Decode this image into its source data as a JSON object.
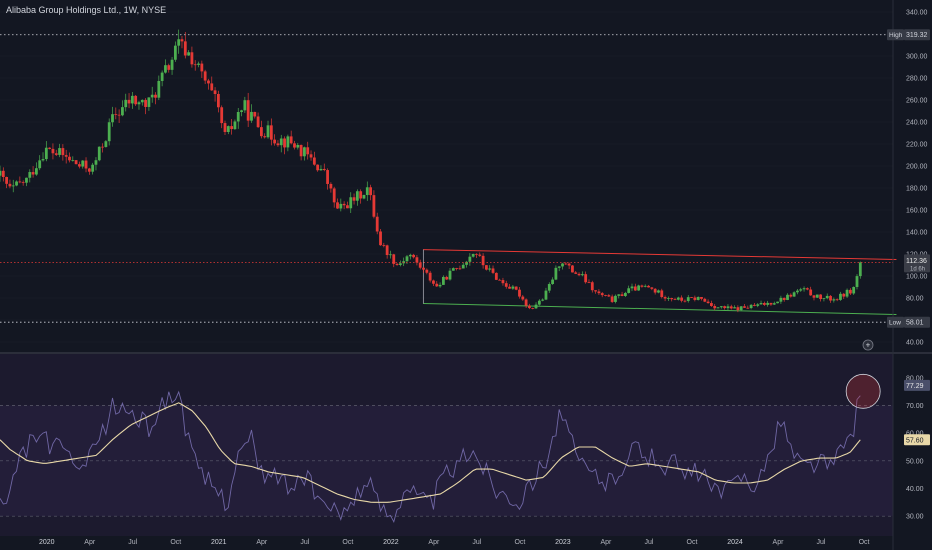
{
  "header": {
    "symbol": "Alibaba Group Holdings Ltd.",
    "interval": "1W",
    "exchange": "NYSE",
    "title_text": "Alibaba Group Holdings Ltd., 1W, NYSE"
  },
  "colors": {
    "background": "#131722",
    "up": "#4caf50",
    "down": "#e53935",
    "grid": "#2a2e39",
    "text": "#b2b5be",
    "rsi_line": "#7e74b8",
    "rsi_ma": "#e8d8a8",
    "resistance": "#e53935",
    "support": "#4caf50"
  },
  "chart_data": [
    {
      "type": "candlestick",
      "title": "Alibaba Group Holdings Ltd., 1W, NYSE",
      "ylim": [
        40,
        340
      ],
      "y_ticks": [
        "340.00",
        "320.00",
        "300.00",
        "280.00",
        "260.00",
        "240.00",
        "220.00",
        "200.00",
        "180.00",
        "160.00",
        "140.00",
        "120.00",
        "100.00",
        "80.00",
        "60.00",
        "40.00"
      ],
      "x_ticks": [
        "2020",
        "Apr",
        "Jul",
        "Oct",
        "2021",
        "Apr",
        "Jul",
        "Oct",
        "2022",
        "Apr",
        "Jul",
        "Oct",
        "2023",
        "Apr",
        "Jul",
        "Oct",
        "2024",
        "Apr",
        "Jul",
        "Oct"
      ],
      "x_start": "2019-06",
      "x_end": "2024-11",
      "markers": {
        "high": {
          "label": "High",
          "value": 319.32,
          "value_text": "319.32"
        },
        "low": {
          "label": "Low",
          "value": 58.01,
          "value_text": "58.01"
        },
        "current": {
          "value": 112.36,
          "value_text": "112.36",
          "countdown": "1d 6h"
        }
      },
      "trendlines": {
        "resistance": {
          "from": [
            2022.2,
            124
          ],
          "to": [
            2024.95,
            115
          ]
        },
        "support": {
          "from": [
            2022.2,
            75
          ],
          "to": [
            2024.95,
            65
          ]
        }
      },
      "close_path": [
        [
          2019.5,
          206
        ],
        [
          2019.6,
          212
        ],
        [
          2019.7,
          200
        ],
        [
          2019.8,
          178
        ],
        [
          2019.9,
          188
        ],
        [
          2020.0,
          215
        ],
        [
          2020.1,
          210
        ],
        [
          2020.2,
          200
        ],
        [
          2020.28,
          198
        ],
        [
          2020.4,
          245
        ],
        [
          2020.5,
          260
        ],
        [
          2020.6,
          255
        ],
        [
          2020.7,
          285
        ],
        [
          2020.78,
          310
        ],
        [
          2020.85,
          300
        ],
        [
          2020.92,
          280
        ],
        [
          2021.0,
          255
        ],
        [
          2021.05,
          225
        ],
        [
          2021.1,
          240
        ],
        [
          2021.15,
          255
        ],
        [
          2021.25,
          235
        ],
        [
          2021.35,
          225
        ],
        [
          2021.45,
          220
        ],
        [
          2021.55,
          205
        ],
        [
          2021.62,
          195
        ],
        [
          2021.7,
          160
        ],
        [
          2021.8,
          170
        ],
        [
          2021.88,
          180
        ],
        [
          2021.95,
          130
        ],
        [
          2022.05,
          110
        ],
        [
          2022.12,
          120
        ],
        [
          2022.2,
          105
        ],
        [
          2022.28,
          90
        ],
        [
          2022.35,
          102
        ],
        [
          2022.42,
          110
        ],
        [
          2022.5,
          123
        ],
        [
          2022.55,
          110
        ],
        [
          2022.65,
          95
        ],
        [
          2022.75,
          85
        ],
        [
          2022.82,
          70
        ],
        [
          2022.9,
          80
        ],
        [
          2023.0,
          115
        ],
        [
          2023.06,
          105
        ],
        [
          2023.12,
          100
        ],
        [
          2023.2,
          85
        ],
        [
          2023.3,
          78
        ],
        [
          2023.4,
          88
        ],
        [
          2023.5,
          90
        ],
        [
          2023.6,
          82
        ],
        [
          2023.7,
          78
        ],
        [
          2023.8,
          80
        ],
        [
          2023.9,
          72
        ],
        [
          2024.0,
          70
        ],
        [
          2024.1,
          72
        ],
        [
          2024.2,
          75
        ],
        [
          2024.3,
          80
        ],
        [
          2024.4,
          88
        ],
        [
          2024.5,
          80
        ],
        [
          2024.6,
          79
        ],
        [
          2024.65,
          84
        ],
        [
          2024.7,
          88
        ],
        [
          2024.74,
          112
        ]
      ]
    },
    {
      "type": "line",
      "title": "RSI",
      "ylim": [
        25,
        85
      ],
      "y_ticks": [
        "80.00",
        "70.00",
        "60.00",
        "50.00",
        "40.00",
        "30.00"
      ],
      "levels": [
        70,
        50,
        30
      ],
      "readouts": {
        "rsi": 77.29,
        "rsi_text": "77.29",
        "ma": 57.6,
        "ma_text": "57.60"
      },
      "rsi_path": [
        [
          2019.5,
          55
        ],
        [
          2019.6,
          62
        ],
        [
          2019.7,
          40
        ],
        [
          2019.78,
          32
        ],
        [
          2019.85,
          50
        ],
        [
          2019.95,
          60
        ],
        [
          2020.05,
          55
        ],
        [
          2020.15,
          52
        ],
        [
          2020.22,
          45
        ],
        [
          2020.3,
          55
        ],
        [
          2020.4,
          70
        ],
        [
          2020.5,
          68
        ],
        [
          2020.6,
          62
        ],
        [
          2020.7,
          72
        ],
        [
          2020.78,
          75
        ],
        [
          2020.84,
          55
        ],
        [
          2020.9,
          45
        ],
        [
          2021.0,
          40
        ],
        [
          2021.06,
          35
        ],
        [
          2021.12,
          52
        ],
        [
          2021.2,
          58
        ],
        [
          2021.28,
          42
        ],
        [
          2021.35,
          46
        ],
        [
          2021.42,
          40
        ],
        [
          2021.5,
          45
        ],
        [
          2021.58,
          38
        ],
        [
          2021.65,
          32
        ],
        [
          2021.72,
          30
        ],
        [
          2021.8,
          38
        ],
        [
          2021.88,
          42
        ],
        [
          2021.95,
          34
        ],
        [
          2022.02,
          30
        ],
        [
          2022.1,
          42
        ],
        [
          2022.18,
          36
        ],
        [
          2022.25,
          35
        ],
        [
          2022.32,
          45
        ],
        [
          2022.4,
          48
        ],
        [
          2022.48,
          55
        ],
        [
          2022.55,
          48
        ],
        [
          2022.62,
          40
        ],
        [
          2022.7,
          38
        ],
        [
          2022.78,
          35
        ],
        [
          2022.85,
          45
        ],
        [
          2022.92,
          52
        ],
        [
          2023.0,
          68
        ],
        [
          2023.05,
          58
        ],
        [
          2023.12,
          48
        ],
        [
          2023.2,
          45
        ],
        [
          2023.28,
          42
        ],
        [
          2023.35,
          48
        ],
        [
          2023.42,
          55
        ],
        [
          2023.5,
          52
        ],
        [
          2023.58,
          48
        ],
        [
          2023.65,
          50
        ],
        [
          2023.72,
          44
        ],
        [
          2023.8,
          46
        ],
        [
          2023.88,
          40
        ],
        [
          2023.95,
          38
        ],
        [
          2024.05,
          45
        ],
        [
          2024.12,
          42
        ],
        [
          2024.2,
          48
        ],
        [
          2024.28,
          66
        ],
        [
          2024.35,
          52
        ],
        [
          2024.42,
          48
        ],
        [
          2024.5,
          50
        ],
        [
          2024.58,
          48
        ],
        [
          2024.65,
          56
        ],
        [
          2024.7,
          62
        ],
        [
          2024.74,
          77
        ]
      ],
      "ma_path": [
        [
          2019.5,
          62
        ],
        [
          2019.6,
          65
        ],
        [
          2019.7,
          60
        ],
        [
          2019.8,
          54
        ],
        [
          2019.9,
          50
        ],
        [
          2020.0,
          49
        ],
        [
          2020.1,
          50
        ],
        [
          2020.2,
          51
        ],
        [
          2020.3,
          52
        ],
        [
          2020.4,
          58
        ],
        [
          2020.5,
          63
        ],
        [
          2020.6,
          66
        ],
        [
          2020.7,
          69
        ],
        [
          2020.78,
          71
        ],
        [
          2020.86,
          68
        ],
        [
          2020.94,
          62
        ],
        [
          2021.02,
          54
        ],
        [
          2021.1,
          49
        ],
        [
          2021.2,
          48
        ],
        [
          2021.3,
          46
        ],
        [
          2021.4,
          45
        ],
        [
          2021.5,
          44
        ],
        [
          2021.6,
          41
        ],
        [
          2021.7,
          38
        ],
        [
          2021.8,
          36
        ],
        [
          2021.9,
          35
        ],
        [
          2022.0,
          35
        ],
        [
          2022.1,
          36
        ],
        [
          2022.2,
          37
        ],
        [
          2022.3,
          38
        ],
        [
          2022.4,
          42
        ],
        [
          2022.5,
          47
        ],
        [
          2022.6,
          47
        ],
        [
          2022.7,
          45
        ],
        [
          2022.8,
          43
        ],
        [
          2022.9,
          44
        ],
        [
          2023.0,
          51
        ],
        [
          2023.1,
          55
        ],
        [
          2023.2,
          55
        ],
        [
          2023.3,
          51
        ],
        [
          2023.4,
          48
        ],
        [
          2023.5,
          49
        ],
        [
          2023.6,
          48
        ],
        [
          2023.7,
          47
        ],
        [
          2023.8,
          46
        ],
        [
          2023.9,
          43
        ],
        [
          2024.0,
          42
        ],
        [
          2024.1,
          42
        ],
        [
          2024.2,
          43
        ],
        [
          2024.3,
          47
        ],
        [
          2024.4,
          50
        ],
        [
          2024.5,
          51
        ],
        [
          2024.6,
          51
        ],
        [
          2024.68,
          53
        ],
        [
          2024.74,
          57.6
        ]
      ]
    }
  ]
}
